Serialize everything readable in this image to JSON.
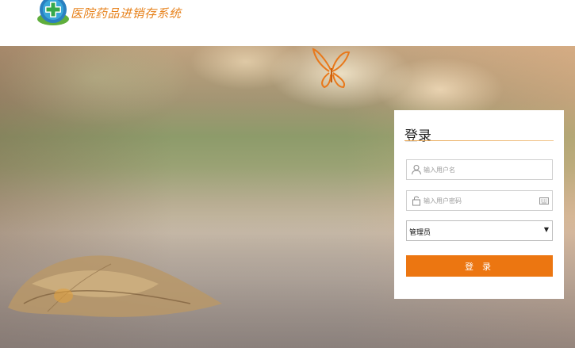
{
  "header": {
    "system_name": "医院药品进销存系统",
    "logo_icon": "medical-cross-icon"
  },
  "login": {
    "title": "登录",
    "username_placeholder": "输入用户名",
    "password_placeholder": "输入用户密码",
    "role_selected": "管理员",
    "submit_label": "登 录"
  },
  "icons": {
    "user": "user-icon",
    "lock": "lock-icon",
    "keyboard": "keyboard-icon",
    "dropdown": "chevron-down-icon",
    "decoration": "butterfly-icon"
  },
  "colors": {
    "accent": "#ec7611",
    "logo_text": "#e7821c",
    "logo_green": "#35a84a",
    "logo_blue": "#2a7fc0"
  }
}
